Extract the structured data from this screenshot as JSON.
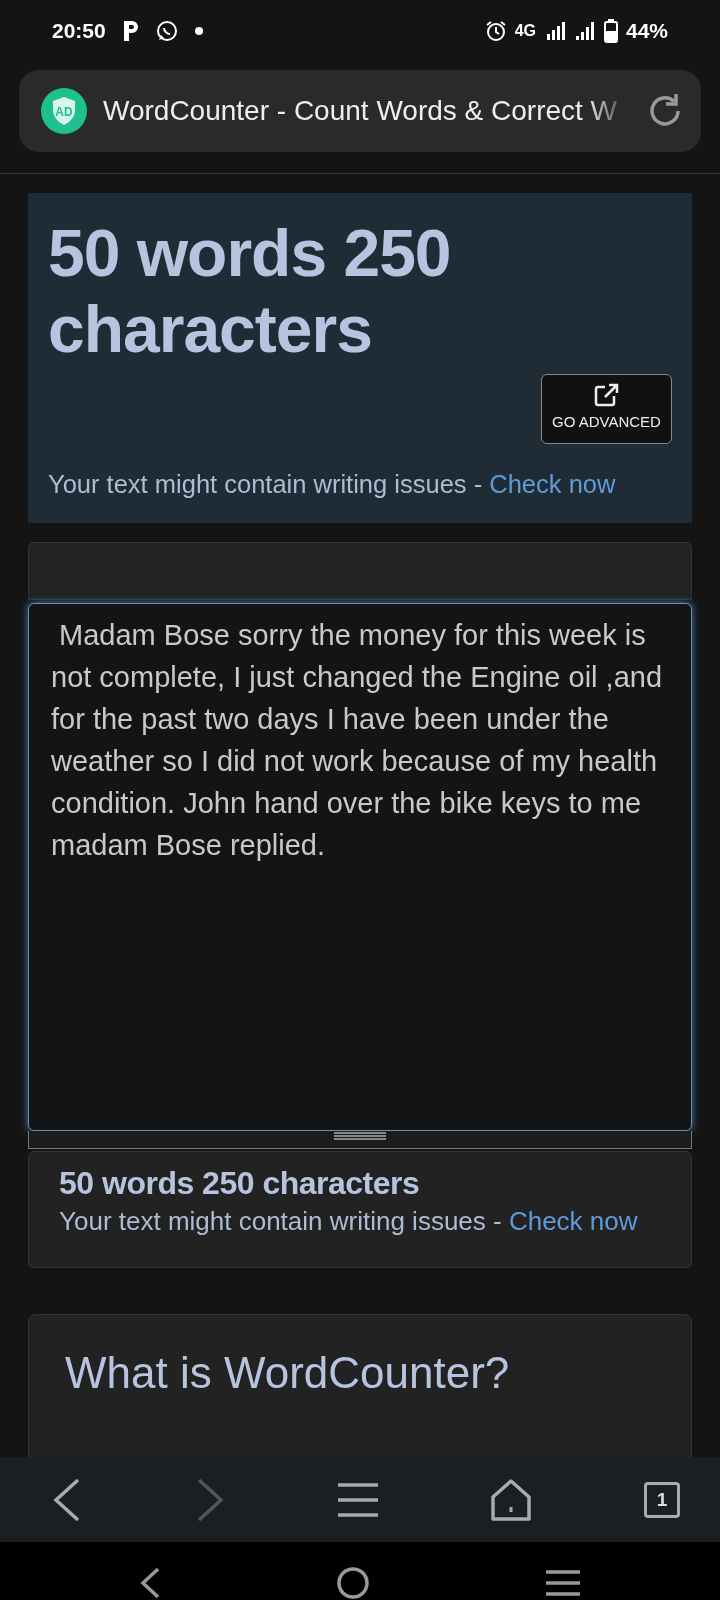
{
  "status_bar": {
    "time": "20:50",
    "battery": "44%",
    "network": "4G"
  },
  "address_bar": {
    "badge": "AD",
    "title": "WordCounter - Count Words & Correct W"
  },
  "header": {
    "count": "50 words 250 characters",
    "advanced_button": "GO ADVANCED",
    "notice": "Your text might contain writing issues - ",
    "link": "Check now"
  },
  "editor": {
    "value": " Madam Bose sorry the money for this week is not complete, I just changed the Engine oil ,and for the past two days I have been under the weather so I did not work because of my health condition. John hand over the bike keys to me madam Bose replied."
  },
  "stats": {
    "count": "50 words 250 characters",
    "notice": "Your text might contain writing issues - ",
    "link": "Check now"
  },
  "about": {
    "title": "What is WordCounter?"
  },
  "browser_toolbar": {
    "back_enabled": true,
    "forward_enabled": false,
    "tabs": "1"
  }
}
